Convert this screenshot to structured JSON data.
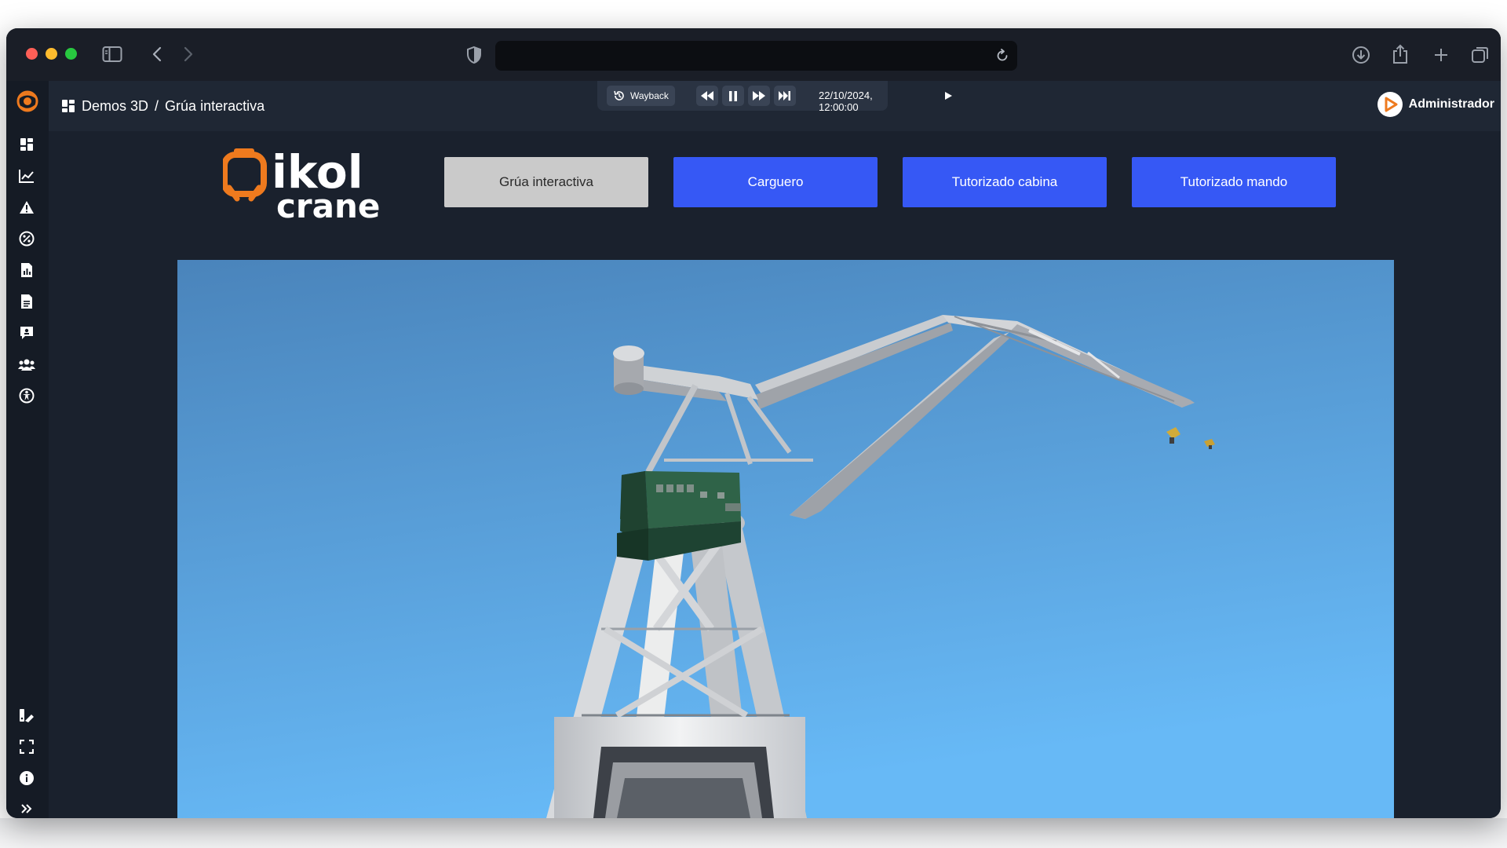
{
  "browser": {
    "url": ""
  },
  "breadcrumb": {
    "parent": "Demos 3D",
    "separator": "/",
    "current": "Grúa interactiva"
  },
  "player": {
    "wayback_label": "Wayback",
    "datetime": "22/10/2024, 12:00:00"
  },
  "user": {
    "name": "Administrador"
  },
  "logo": {
    "word_top": "ikol",
    "word_bottom": "crane"
  },
  "modes": {
    "interactive": "Grúa interactiva",
    "cargo": "Carguero",
    "cabin": "Tutorizado cabina",
    "remote": "Tutorizado mando"
  },
  "sidebar": {
    "items": [
      "dashboard-icon",
      "chart-icon",
      "alert-icon",
      "percent-icon",
      "report-icon",
      "document-icon",
      "comment-icon",
      "users-icon",
      "globe-icon"
    ],
    "bottom_items": [
      "palette-icon",
      "fullscreen-icon",
      "info-icon",
      "expand-icon"
    ]
  },
  "colors": {
    "accent": "#3658f5",
    "active_button": "#cacaca",
    "brand_orange": "#ee7a1e",
    "sky_top": "#4a84bb",
    "sky_bottom": "#67b9f6",
    "cabin_green": "#2f6348"
  }
}
